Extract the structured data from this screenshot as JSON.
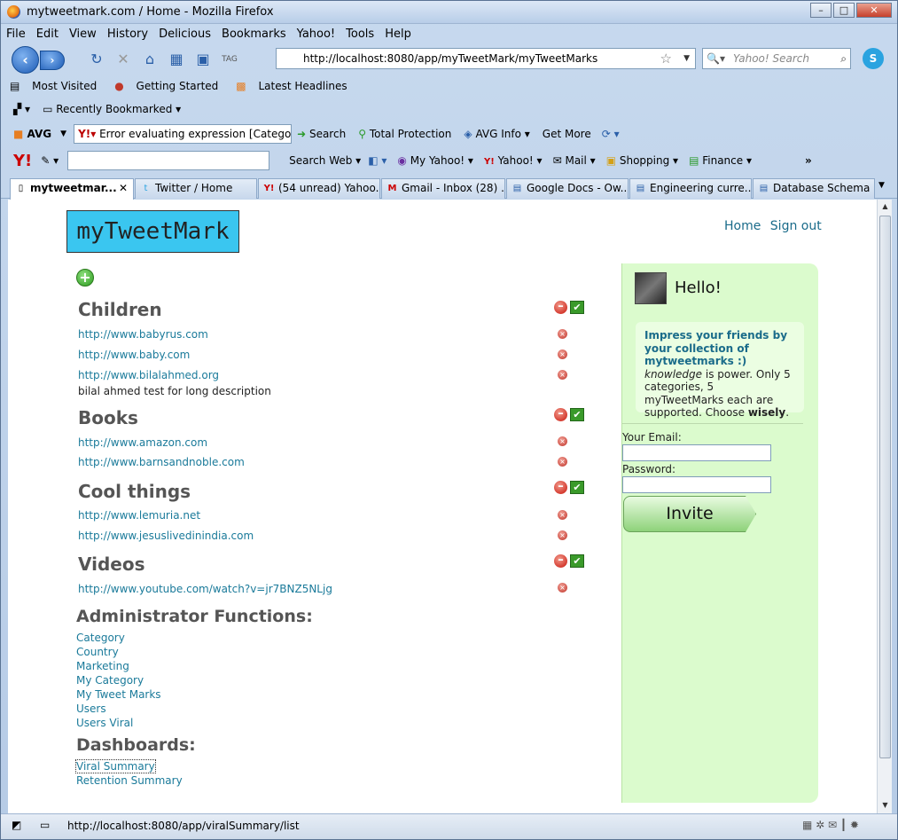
{
  "window": {
    "title": "mytweetmark.com / Home - Mozilla Firefox"
  },
  "menu": [
    "File",
    "Edit",
    "View",
    "History",
    "Delicious",
    "Bookmarks",
    "Yahoo!",
    "Tools",
    "Help"
  ],
  "nav": {
    "url": "http://localhost:8080/app/myTweetMark/myTweetMarks",
    "search_placeholder": "Yahoo! Search"
  },
  "bookmarks": {
    "most_visited": "Most Visited",
    "getting_started": "Getting Started",
    "latest_headlines": "Latest Headlines",
    "recently_bookmarked": "Recently Bookmarked"
  },
  "avg": {
    "label": "AVG",
    "search_value": "Error evaluating expression [Categor",
    "search": "Search",
    "total_protection": "Total Protection",
    "avg_info": "AVG Info",
    "get_more": "Get More"
  },
  "yahoo_bar": {
    "search_web": "Search Web",
    "my_yahoo": "My Yahoo!",
    "yahoo": "Yahoo!",
    "mail": "Mail",
    "shopping": "Shopping",
    "finance": "Finance",
    "more": "»"
  },
  "tabs": [
    "mytweetmar...",
    "Twitter / Home",
    "(54 unread) Yahoo...",
    "Gmail - Inbox (28) ...",
    "Google Docs - Ow...",
    "Engineering curre...",
    "Database Schema ..."
  ],
  "page": {
    "logo": "myTweetMark",
    "home": "Home",
    "sign_out": "Sign out",
    "categories": [
      {
        "name": "Children",
        "links": [
          "http://www.babyrus.com",
          "http://www.baby.com",
          "http://www.bilalahmed.org"
        ],
        "desc": "bilal ahmed test for long description"
      },
      {
        "name": "Books",
        "links": [
          "http://www.amazon.com",
          "http://www.barnsandnoble.com"
        ]
      },
      {
        "name": "Cool things",
        "links": [
          "http://www.lemuria.net",
          "http://www.jesuslivedinindia.com"
        ]
      },
      {
        "name": "Videos",
        "links": [
          "http://www.youtube.com/watch?v=jr7BNZ5NLjg"
        ]
      }
    ],
    "admin_title": "Administrator Functions:",
    "admin_links": [
      "Category",
      "Country",
      "Marketing",
      "My Category",
      "My Tweet Marks",
      "Users",
      "Users Viral"
    ],
    "dash_title": "Dashboards:",
    "dash_links": [
      "Viral Summary",
      "Retention Summary"
    ]
  },
  "sidebar": {
    "hello": "Hello!",
    "headline": "Impress your friends by your collection of mytweetmarks :)",
    "knowledge": "knowledge",
    "body": " is power. Only 5 categories, 5 myTweetMarks each are supported. Choose ",
    "wisely": "wisely",
    "period": ".",
    "email_label": "Your Email:",
    "password_label": "Password:",
    "invite": "Invite"
  },
  "status": {
    "text": "http://localhost:8080/app/viralSummary/list"
  }
}
